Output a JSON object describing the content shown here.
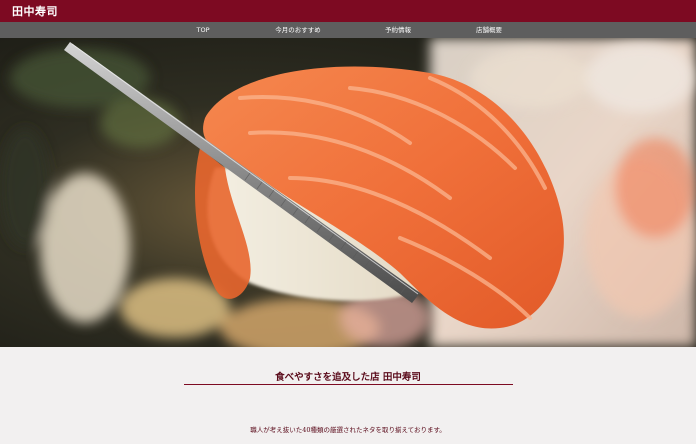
{
  "header": {
    "site_title": "田中寿司"
  },
  "nav": {
    "items": [
      {
        "label": "TOP"
      },
      {
        "label": "今月のおすすめ"
      },
      {
        "label": "予約情報"
      },
      {
        "label": "店舗概要"
      }
    ]
  },
  "content": {
    "tagline": "食べやすさを追及した店 田中寿司",
    "description": "職人が考え抜いた40種類の厳選されたネタを取り揃えております。"
  },
  "colors": {
    "brand": "#7d0a22",
    "nav_bg": "#5e5e5e",
    "page_bg": "#f2f0f0"
  }
}
